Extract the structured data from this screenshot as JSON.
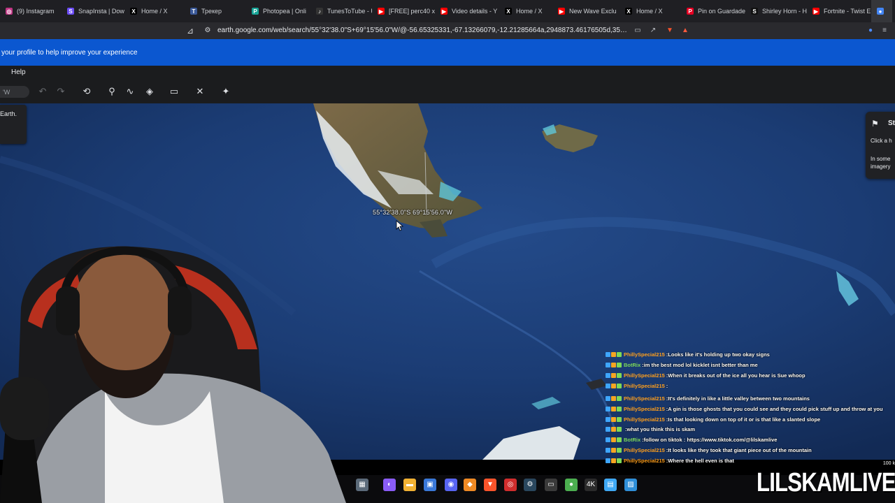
{
  "tabs": [
    {
      "label": "(9) Instagram",
      "color": "#c13584",
      "glyph": "◎"
    },
    {
      "label": "SnapInsta | Dow",
      "color": "#6b4cf6",
      "glyph": "S"
    },
    {
      "label": "Home / X",
      "color": "#000000",
      "glyph": "X"
    },
    {
      "label": "Трекер",
      "color": "#3b5998",
      "glyph": "T"
    },
    {
      "label": "Photopea | Onli",
      "color": "#18a497",
      "glyph": "P"
    },
    {
      "label": "TunesToTube - U",
      "color": "#333333",
      "glyph": "♪"
    },
    {
      "label": "[FREE] perc40 x",
      "color": "#ff0000",
      "glyph": "▶"
    },
    {
      "label": "Video details - Y",
      "color": "#ff0000",
      "glyph": "▶"
    },
    {
      "label": "Home / X",
      "color": "#000000",
      "glyph": "X"
    },
    {
      "label": "New Wave Exclu",
      "color": "#ff0000",
      "glyph": "▶"
    },
    {
      "label": "Home / X",
      "color": "#000000",
      "glyph": "X"
    },
    {
      "label": "Pin on Guardade",
      "color": "#e60023",
      "glyph": "P"
    },
    {
      "label": "Shirley Horn - He",
      "color": "#111111",
      "glyph": "S"
    },
    {
      "label": "Fortnite - Twist E",
      "color": "#ff0000",
      "glyph": "▶"
    },
    {
      "label": "",
      "color": "#4285f4",
      "glyph": "●",
      "active": true
    }
  ],
  "address": {
    "url": "earth.google.com/web/search/55°32'38.0\"S+69°15'56.0\"W/@-56.65325331,-67.13266079,-12.21285664a,2948873.46176505d,35y,-0h,0t,..."
  },
  "banner": {
    "text": "your profile to help improve your experience"
  },
  "menu": {
    "help": "Help"
  },
  "toolbar": {
    "coord_value": "'W"
  },
  "side_panel": {
    "text": "Earth."
  },
  "right_card": {
    "title": "St",
    "line1": "Click a h",
    "line2": "In some",
    "line3": "imagery"
  },
  "map": {
    "coordinate_label": "55°32'38.0\"S 69°15'56.0\"W",
    "scale_label": "100 k"
  },
  "chat": [
    {
      "user": "PhillySpecial215",
      "user_color": "#ff9f1c",
      "msg": "Looks like it's holding up two okay signs"
    },
    {
      "user": "BotRix",
      "user_color": "#7ed957",
      "msg": "im the best mod lol kicklet isnt better than me"
    },
    {
      "user": "PhillySpecial215",
      "user_color": "#ff9f1c",
      "msg": "When it breaks out of the ice all you hear is Sue whoop"
    },
    {
      "user": "PhillySpecial215",
      "user_color": "#ff9f1c",
      "msg": ""
    },
    {
      "user": "PhillySpecial215",
      "user_color": "#ff9f1c",
      "msg": "It's definitely in like a little valley between two mountains"
    },
    {
      "user": "PhillySpecial215",
      "user_color": "#ff9f1c",
      "msg": "A gin is those ghosts that you could see and they could pick stuff up and throw at you"
    },
    {
      "user": "PhillySpecial215",
      "user_color": "#ff9f1c",
      "msg": "Is that looking down on top of it or is that like a slanted slope"
    },
    {
      "user": "",
      "user_color": "#d0021b",
      "msg": "what you think this is skam"
    },
    {
      "user": "BotRix",
      "user_color": "#7ed957",
      "msg": "follow on tiktok : https://www.tiktok.com/@lilskamlive"
    },
    {
      "user": "PhillySpecial215",
      "user_color": "#ff9f1c",
      "msg": "It looks like they took that giant piece out of the mountain"
    },
    {
      "user": "PhillySpecial215",
      "user_color": "#ff9f1c",
      "msg": "Where the hell even is that"
    }
  ],
  "taskbar": [
    {
      "name": "search-taskbar-icon",
      "color": "#3c3c3c",
      "glyph": "⌕"
    },
    {
      "name": "task-view-icon",
      "color": "#5c6b7a",
      "glyph": "▦"
    },
    {
      "name": "copilot-icon",
      "color": "#8a5cf6",
      "glyph": "◐"
    },
    {
      "name": "file-explorer-icon",
      "color": "#f2b233",
      "glyph": "▬"
    },
    {
      "name": "ms-store-icon",
      "color": "#3a78d8",
      "glyph": "▣"
    },
    {
      "name": "discord-icon",
      "color": "#5865f2",
      "glyph": "◉"
    },
    {
      "name": "app-icon-orange",
      "color": "#f08a24",
      "glyph": "◆"
    },
    {
      "name": "brave-icon",
      "color": "#fb542b",
      "glyph": "▼"
    },
    {
      "name": "app-icon-red",
      "color": "#d12d2d",
      "glyph": "◎"
    },
    {
      "name": "steam-icon",
      "color": "#2a475e",
      "glyph": "⚙"
    },
    {
      "name": "app-icon-gray",
      "color": "#3a3a3a",
      "glyph": "▭"
    },
    {
      "name": "app-icon-green",
      "color": "#4caf50",
      "glyph": "●"
    },
    {
      "name": "app-icon-4k",
      "color": "#2b2b2b",
      "glyph": "4K"
    },
    {
      "name": "notepad-icon",
      "color": "#3fa9f5",
      "glyph": "▤"
    },
    {
      "name": "photos-icon",
      "color": "#2f8fd8",
      "glyph": "▨"
    }
  ],
  "watermark": {
    "text": "LILSKAMLIVE"
  },
  "colors": {
    "banner": "#0b57d0",
    "chrome": "#1f1f23",
    "ocean": "#1d3f7a"
  }
}
